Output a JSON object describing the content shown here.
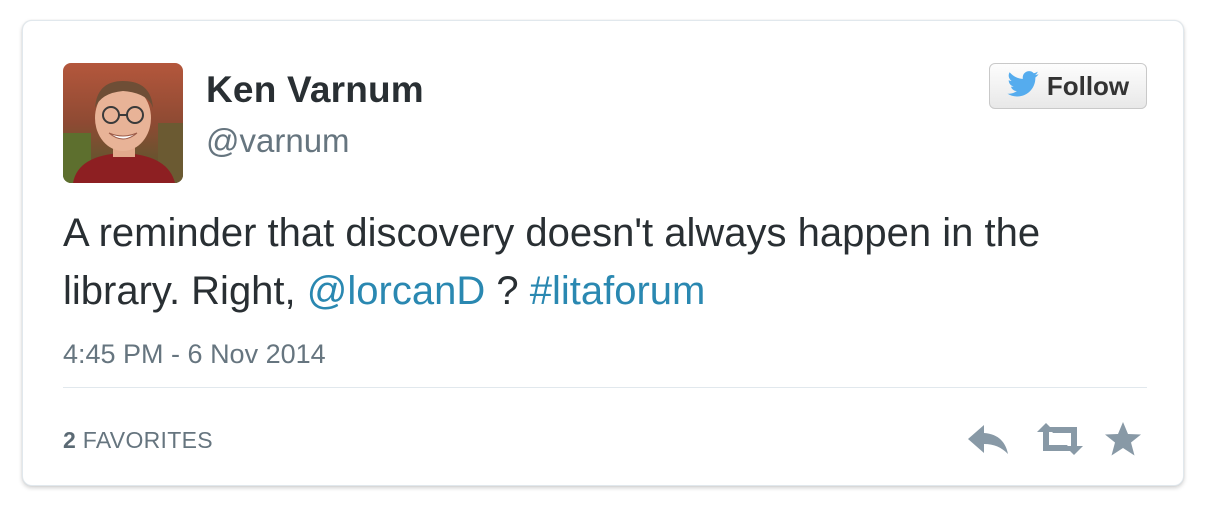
{
  "author": {
    "name": "Ken Varnum",
    "handle": "@varnum",
    "avatar_icon": "profile-photo"
  },
  "follow_button": {
    "label": "Follow",
    "icon": "twitter-bird-icon",
    "icon_color": "#55acee"
  },
  "tweet": {
    "text_part1": "A reminder that discovery doesn't always happen in the library. Right, ",
    "mention": "@lorcanD",
    "text_part2": " ? ",
    "hashtag": "#litaforum",
    "link_color": "#2a88b1"
  },
  "timestamp": "4:45 PM - 6 Nov 2014",
  "stats": {
    "favorites_count": "2",
    "favorites_label": "FAVORITES"
  },
  "actions": [
    {
      "name": "reply",
      "icon": "reply-icon"
    },
    {
      "name": "retweet",
      "icon": "retweet-icon"
    },
    {
      "name": "favorite",
      "icon": "star-icon"
    }
  ],
  "colors": {
    "text_primary": "#292f33",
    "text_secondary": "#66757f",
    "action_icon": "#8899a6"
  }
}
